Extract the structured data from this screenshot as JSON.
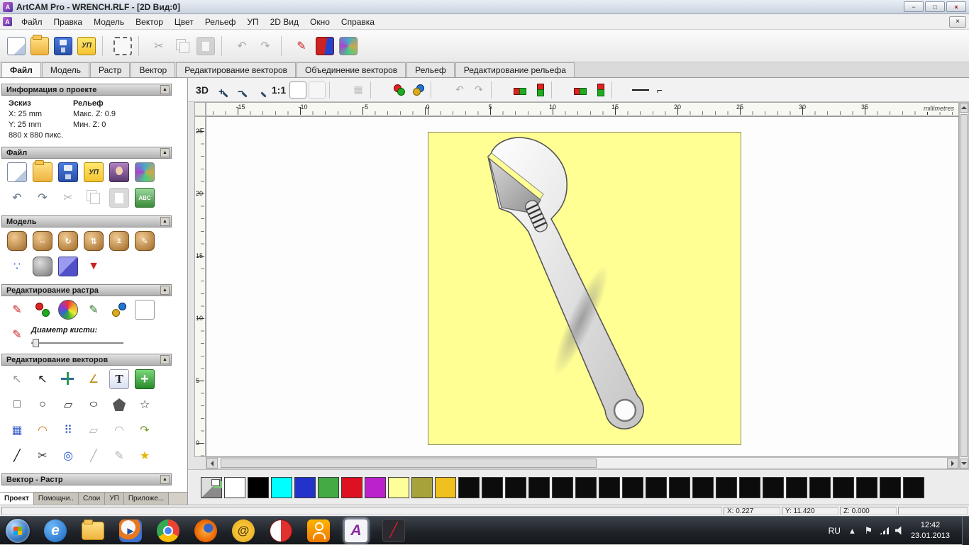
{
  "ui": {
    "collapse_glyph": "▲"
  },
  "window": {
    "title": "ArtCAM Pro - WRENCH.RLF - [2D Вид:0]",
    "buttons": {
      "minimize": "−",
      "maximize": "□",
      "close": "×",
      "child_close": "×"
    },
    "app_initial": "A"
  },
  "menu": {
    "items": [
      {
        "key": "file",
        "label": "Файл"
      },
      {
        "key": "edit",
        "label": "Правка"
      },
      {
        "key": "model",
        "label": "Модель"
      },
      {
        "key": "vector",
        "label": "Вектор"
      },
      {
        "key": "colour",
        "label": "Цвет"
      },
      {
        "key": "relief",
        "label": "Рельеф"
      },
      {
        "key": "toolpaths",
        "label": "УП"
      },
      {
        "key": "view-2d",
        "label": "2D Вид"
      },
      {
        "key": "window",
        "label": "Окно"
      },
      {
        "key": "help",
        "label": "Справка"
      }
    ]
  },
  "main_toolbar": {
    "icons": [
      {
        "key": "new",
        "cls": "a-page"
      },
      {
        "key": "open",
        "cls": "a-folder"
      },
      {
        "key": "save",
        "cls": "a-save"
      },
      {
        "key": "toolpath",
        "cls": "a-toolpath",
        "glyph": "УП"
      },
      {
        "key": "sep1",
        "cls": "sep",
        "interactable": false
      },
      {
        "key": "marquee",
        "cls": "a-marquee"
      },
      {
        "key": "sep2",
        "cls": "sep",
        "interactable": false
      },
      {
        "key": "cut",
        "glyph": "✂",
        "dis": true
      },
      {
        "key": "copy",
        "cls": "a-copy",
        "dis": true
      },
      {
        "key": "paste",
        "cls": "a-paste",
        "dis": true
      },
      {
        "key": "sep3",
        "cls": "sep",
        "interactable": false
      },
      {
        "key": "undo",
        "glyph": "↶",
        "dis": true
      },
      {
        "key": "redo",
        "glyph": "↷",
        "dis": true
      },
      {
        "key": "sep4",
        "cls": "sep",
        "interactable": false
      },
      {
        "key": "edit-pencil",
        "glyph": "✎",
        "fg": "#cc2222"
      },
      {
        "key": "reference-book",
        "cls": "a-book"
      },
      {
        "key": "wizard",
        "cls": "a-wizard"
      }
    ]
  },
  "tabs": {
    "items": [
      {
        "key": "file",
        "label": "Файл",
        "active": true
      },
      {
        "key": "model",
        "label": "Модель"
      },
      {
        "key": "raster",
        "label": "Растр"
      },
      {
        "key": "vector",
        "label": "Вектор"
      },
      {
        "key": "vector-edit",
        "label": "Редактирование векторов"
      },
      {
        "key": "vector-merge",
        "label": "Объединение векторов"
      },
      {
        "key": "relief",
        "label": "Рельеф"
      },
      {
        "key": "relief-edit",
        "label": "Редактирование рельефа"
      }
    ]
  },
  "panel": {
    "project_info": {
      "title": "Информация о проекте",
      "sketch_label": "Эскиз",
      "relief_label": "Рельеф",
      "x": "X: 25 mm",
      "y": "Y: 25 mm",
      "max_z": "Макс. Z: 0.9",
      "min_z": "Мин. Z: 0",
      "pixels": "880 x 880 пикс."
    },
    "file": {
      "title": "Файл",
      "row1": [
        {
          "key": "new",
          "cls": "a-page"
        },
        {
          "key": "open",
          "cls": "a-folder"
        },
        {
          "key": "save",
          "cls": "a-save"
        },
        {
          "key": "toolpath",
          "cls": "a-toolpath",
          "glyph": "УП"
        },
        {
          "key": "face-wizard",
          "cls": "a-person"
        },
        {
          "key": "wizard",
          "cls": "a-wizard"
        }
      ],
      "row2": [
        {
          "key": "undo",
          "glyph": "↶",
          "fg": "#667788"
        },
        {
          "key": "redo",
          "glyph": "↷",
          "fg": "#667788"
        },
        {
          "key": "cut",
          "glyph": "✂",
          "dis": true
        },
        {
          "key": "copy",
          "cls": "a-copy",
          "dis": true
        },
        {
          "key": "paste",
          "cls": "a-paste",
          "dis": true
        },
        {
          "key": "abc-labels",
          "cls": "a-abc",
          "glyph": "ABC"
        }
      ]
    },
    "model": {
      "title": "Модель",
      "row1": [
        {
          "key": "set-size",
          "cls": "a-bear"
        },
        {
          "key": "mirror",
          "cls": "a-bear",
          "glyph": "↔",
          "fg": "#ffffff"
        },
        {
          "key": "rotate",
          "cls": "a-bear",
          "glyph": "↻",
          "fg": "#ffffff"
        },
        {
          "key": "invert",
          "cls": "a-bear",
          "glyph": "⇅",
          "fg": "#ffffff"
        },
        {
          "key": "scale",
          "cls": "a-bear",
          "glyph": "±",
          "fg": "#ffffff"
        },
        {
          "key": "sculpt",
          "cls": "a-bear",
          "glyph": "✎",
          "fg": "#ffffff"
        }
      ],
      "row2": [
        {
          "key": "lights",
          "glyph": "∵",
          "fg": "#2a6ae0"
        },
        {
          "key": "greyscale",
          "cls": "a-bear gray"
        },
        {
          "key": "slice-blocks",
          "cls": "a-blocks"
        },
        {
          "key": "rotary",
          "glyph": "▼",
          "fg": "#cc2222"
        }
      ]
    },
    "raster": {
      "title": "Редактирование растра",
      "row1": [
        {
          "key": "paint",
          "glyph": "✎",
          "fg": "#cc2222"
        },
        {
          "key": "colour-transfer",
          "cls": "a-two-dots"
        },
        {
          "key": "palette",
          "cls": "a-palette"
        },
        {
          "key": "texture-paint",
          "glyph": "✎",
          "fg": "#2a7a2a"
        },
        {
          "key": "link-colours",
          "cls": "a-two-dots2"
        },
        {
          "key": "swatch-blank",
          "cls": "a-blank"
        }
      ],
      "brush_label": "Диаметр кисти:",
      "pencil_glyph": "✎"
    },
    "vector": {
      "title": "Редактирование векторов",
      "row1": [
        {
          "key": "select",
          "glyph": "↖",
          "fg": "#999999"
        },
        {
          "key": "node-edit",
          "glyph": "↖",
          "fg": "#111111"
        },
        {
          "key": "transform",
          "cls": "a-move"
        },
        {
          "key": "measure",
          "glyph": "∠",
          "fg": "#b8860b"
        },
        {
          "key": "create-text",
          "cls": "a-text",
          "glyph": "T"
        },
        {
          "key": "green-plus",
          "cls": "a-cross",
          "glyph": "+"
        }
      ],
      "row2": [
        {
          "key": "rectangle",
          "glyph": "□",
          "fg": "#333333"
        },
        {
          "key": "circle",
          "glyph": "○",
          "fg": "#333333"
        },
        {
          "key": "polyline",
          "glyph": "▱",
          "fg": "#333333"
        },
        {
          "key": "ellipse",
          "glyph": "○",
          "cls": "a-ellipse",
          "fg": "#333333"
        },
        {
          "key": "polygon",
          "cls": "a-pent"
        },
        {
          "key": "star",
          "glyph": "☆",
          "fg": "#333333"
        }
      ],
      "row3": [
        {
          "key": "block-copy",
          "glyph": "▦",
          "fg": "#4466cc"
        },
        {
          "key": "arc",
          "glyph": "◠",
          "fg": "#cc7722"
        },
        {
          "key": "dot-grid",
          "glyph": "⠿",
          "fg": "#3355bb"
        },
        {
          "key": "tool-a",
          "glyph": "▱",
          "dis": true
        },
        {
          "key": "tool-b",
          "glyph": "◠",
          "dis": true
        },
        {
          "key": "offset",
          "glyph": "↷",
          "fg": "#7a9a2a"
        }
      ],
      "row4": [
        {
          "key": "join",
          "glyph": "╱",
          "fg": "#111111"
        },
        {
          "key": "trim",
          "glyph": "✂",
          "fg": "#333333"
        },
        {
          "key": "spin",
          "glyph": "◎",
          "fg": "#2255cc"
        },
        {
          "key": "slice",
          "glyph": "╱",
          "dis": true
        },
        {
          "key": "pen",
          "glyph": "✎",
          "dis": true
        },
        {
          "key": "magic-star",
          "glyph": "★",
          "fg": "#e8b800"
        }
      ]
    },
    "vector_raster": {
      "title": "Вектор - Растр"
    },
    "tabs": [
      {
        "key": "project",
        "label": "Проект",
        "active": true
      },
      {
        "key": "assistant",
        "label": "Помощни.."
      },
      {
        "key": "layers",
        "label": "Слои"
      },
      {
        "key": "toolpaths",
        "label": "УП"
      },
      {
        "key": "attach",
        "label": "Приложе..."
      }
    ]
  },
  "canvas": {
    "toolbar": [
      {
        "key": "view-3d",
        "glyph": "3D",
        "cls": "a-txt"
      },
      {
        "key": "zoom-in",
        "glyph": "+",
        "cls": "a-zoomin"
      },
      {
        "key": "zoom-out",
        "glyph": "−",
        "cls": "a-zoomout"
      },
      {
        "key": "zoom-window",
        "cls": "a-zoomwin"
      },
      {
        "key": "zoom-1-1",
        "glyph": "1:1",
        "cls": "a-txt"
      },
      {
        "key": "frame-on",
        "cls": "a-blank"
      },
      {
        "key": "frame-off",
        "cls": "a-blank",
        "dis": true
      },
      {
        "key": "sep1",
        "cls": "sep",
        "interactable": false
      },
      {
        "key": "preview-grid",
        "glyph": "▦",
        "cls": "a-grid",
        "dis": true
      },
      {
        "key": "sep2",
        "cls": "sep",
        "interactable": false
      },
      {
        "key": "toggle-bitmap",
        "cls": "a-two-dots"
      },
      {
        "key": "toggle-vectors",
        "cls": "a-two-dots2"
      },
      {
        "key": "sep3",
        "cls": "sep",
        "interactable": false
      },
      {
        "key": "undo",
        "glyph": "↶",
        "dis": true
      },
      {
        "key": "redo",
        "glyph": "↷",
        "dis": true
      },
      {
        "key": "sep4",
        "cls": "sep",
        "interactable": false
      },
      {
        "key": "weld-1",
        "cls": "a-weld"
      },
      {
        "key": "weld-2",
        "cls": "a-weld2"
      },
      {
        "key": "sep5",
        "cls": "sep",
        "interactable": false
      },
      {
        "key": "weld-3",
        "cls": "a-weld"
      },
      {
        "key": "weld-4",
        "cls": "a-weld2"
      },
      {
        "key": "sep6",
        "cls": "sep",
        "interactable": false
      },
      {
        "key": "line-width",
        "cls": "a-line"
      },
      {
        "key": "line-style",
        "glyph": "⌐",
        "cls": "a-txt"
      }
    ],
    "ruler_h": {
      "labels": [
        -15,
        -10,
        -5,
        0,
        5,
        10,
        15,
        20,
        25,
        30,
        35
      ],
      "unit": "millimetres"
    },
    "ruler_v": {
      "labels": [
        25,
        20,
        15,
        10,
        5,
        0
      ]
    }
  },
  "palette": {
    "colors": [
      {
        "key": "layer-link",
        "cls": "a-swspecial"
      },
      {
        "key": "white",
        "bg": "#ffffff"
      },
      {
        "key": "black",
        "bg": "#000000"
      },
      {
        "key": "cyan",
        "bg": "#00ffff"
      },
      {
        "key": "blue",
        "bg": "#2233cc"
      },
      {
        "key": "green",
        "bg": "#44aa44"
      },
      {
        "key": "red",
        "bg": "#dd1122"
      },
      {
        "key": "magenta",
        "bg": "#bb22cc"
      },
      {
        "key": "yellow",
        "bg": "#ffff99"
      },
      {
        "key": "olive",
        "bg": "#a8a23a"
      },
      {
        "key": "gold",
        "bg": "#f0c020"
      },
      {
        "bg": "#0c0c0c"
      },
      {
        "bg": "#0c0c0c"
      },
      {
        "bg": "#0c0c0c"
      },
      {
        "bg": "#0c0c0c"
      },
      {
        "bg": "#0c0c0c"
      },
      {
        "bg": "#0c0c0c"
      },
      {
        "bg": "#0c0c0c"
      },
      {
        "bg": "#0c0c0c"
      },
      {
        "bg": "#0c0c0c"
      },
      {
        "bg": "#0c0c0c"
      },
      {
        "bg": "#0c0c0c"
      },
      {
        "bg": "#0c0c0c"
      },
      {
        "bg": "#0c0c0c"
      },
      {
        "bg": "#0c0c0c"
      },
      {
        "bg": "#0c0c0c"
      },
      {
        "bg": "#0c0c0c"
      },
      {
        "bg": "#0c0c0c"
      },
      {
        "bg": "#0c0c0c"
      },
      {
        "bg": "#0c0c0c"
      },
      {
        "bg": "#0c0c0c"
      }
    ]
  },
  "status": {
    "x_label": "X: 0.227",
    "y_label": "Y: 11.420",
    "z_label": "Z: 0.000"
  },
  "taskbar": {
    "lang": "RU",
    "time": "12:42",
    "date": "23.01.2013",
    "apps": [
      {
        "key": "internet-explorer",
        "cls": "a-ie",
        "glyph": "e"
      },
      {
        "key": "explorer",
        "cls": "a-folder tfold"
      },
      {
        "key": "media-player",
        "cls": "a-wmp",
        "glyph": "▶"
      },
      {
        "key": "chrome",
        "cls": "a-chrome"
      },
      {
        "key": "firefox",
        "cls": "a-firefox"
      },
      {
        "key": "mail-agent",
        "cls": "a-mail",
        "glyph": "@"
      },
      {
        "key": "browser",
        "cls": "a-ya"
      },
      {
        "key": "odnoklassniki",
        "cls": "a-ok"
      },
      {
        "key": "artcam",
        "cls": "a-artcam",
        "glyph": "A",
        "active": true
      },
      {
        "key": "graphics-editor",
        "cls": "a-brush",
        "glyph": "╱"
      }
    ],
    "tray_icons": [
      {
        "key": "hidden-icons",
        "glyph": "▴"
      },
      {
        "key": "action-center",
        "glyph": "⚑"
      },
      {
        "key": "network",
        "cls": "t-net"
      },
      {
        "key": "volume",
        "cls": "t-vol"
      }
    ]
  }
}
